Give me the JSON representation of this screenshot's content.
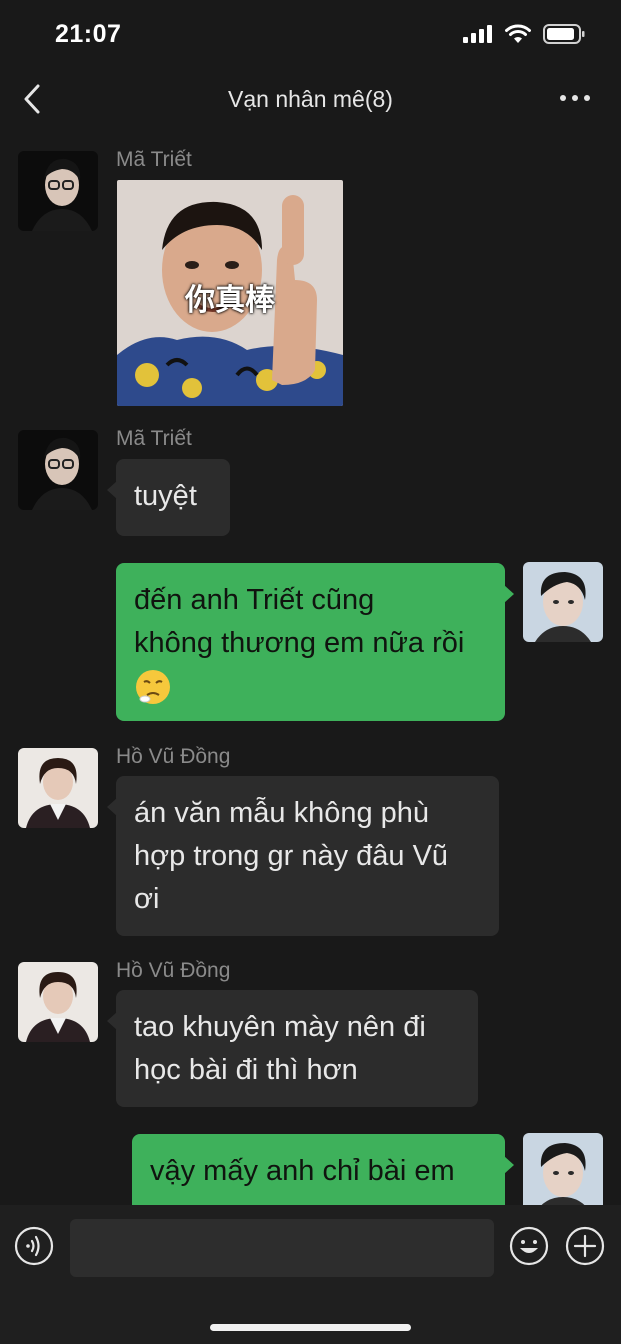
{
  "status_bar": {
    "time": "21:07"
  },
  "header": {
    "title": "Vạn nhân mê(8)"
  },
  "messages": [
    {
      "sender": "Mã Triết",
      "sticker_text": "你真棒"
    },
    {
      "sender": "Mã Triết",
      "text": "tuyệt"
    },
    {
      "line1": "đến anh Triết cũng",
      "line2": "không thương em nữa rồi",
      "emoji": "sad-face-emoji"
    },
    {
      "sender": "Hồ Vũ Đồng",
      "line1": "án văn mẫu không phù",
      "line2": "hợp trong gr này đâu Vũ",
      "line3": "ơi"
    },
    {
      "sender": "Hồ Vũ Đồng",
      "line1": "tao khuyên mày nên đi",
      "line2": "học bài đi thì hơn"
    },
    {
      "line1": "vậy mấy anh chỉ bài em"
    }
  ],
  "colors": {
    "background": "#191919",
    "bubble_in": "#2c2c2c",
    "bubble_out": "#3eb15b"
  }
}
